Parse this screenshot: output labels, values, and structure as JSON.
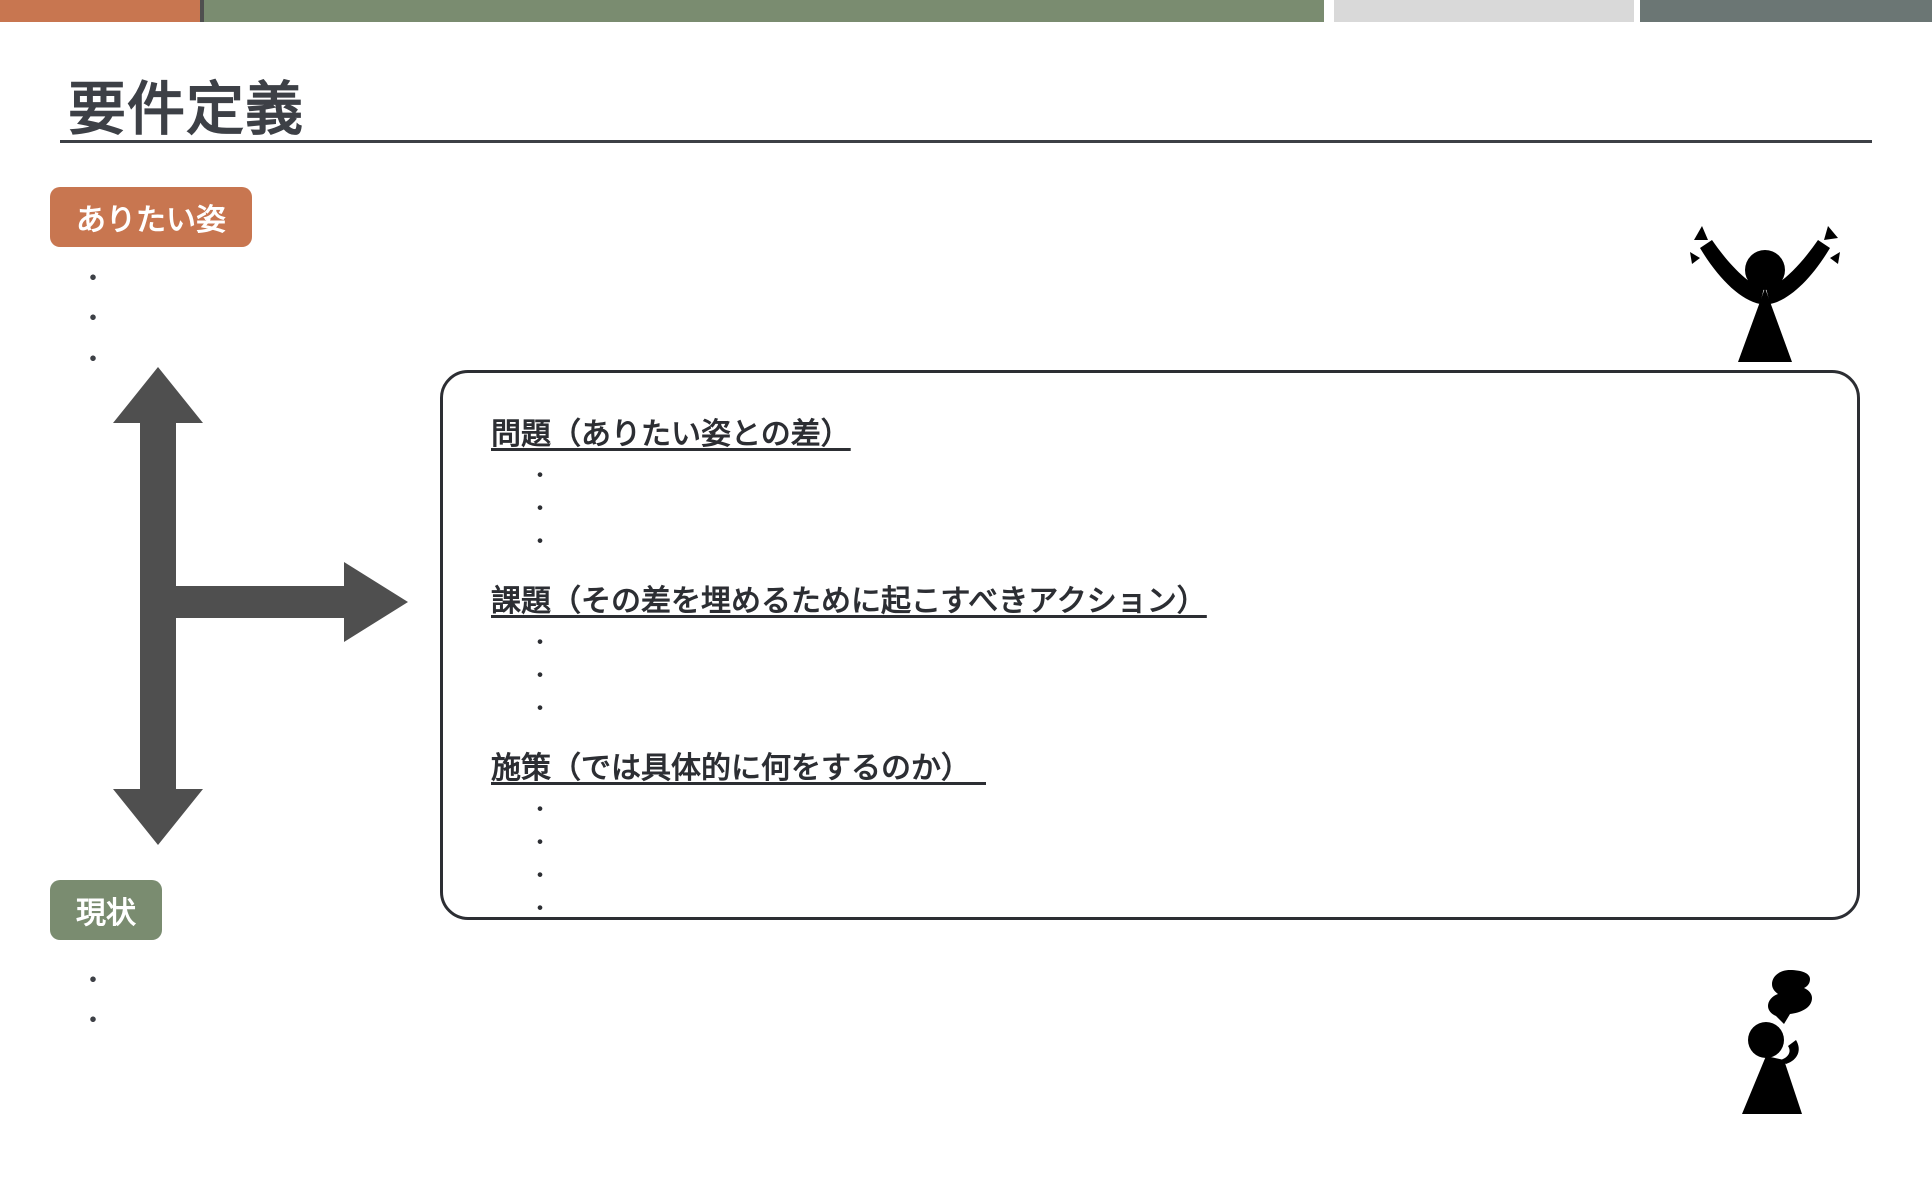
{
  "slide": {
    "title": "要件定義",
    "badges": {
      "desired": "ありたい姿",
      "current": "現状"
    },
    "desired_bullets": [
      "・",
      "・",
      "・"
    ],
    "current_bullets": [
      "・",
      "・"
    ],
    "box": {
      "problem": {
        "title": "問題（ありたい姿との差）",
        "bullets": [
          "・",
          "・",
          "・"
        ]
      },
      "task": {
        "title": "課題（その差を埋めるために起こすべきアクション）",
        "bullets": [
          "・",
          "・",
          "・"
        ]
      },
      "measure": {
        "title": "施策（では具体的に何をするのか）　",
        "bullets": [
          "・",
          "・",
          "・",
          "・"
        ]
      }
    }
  }
}
